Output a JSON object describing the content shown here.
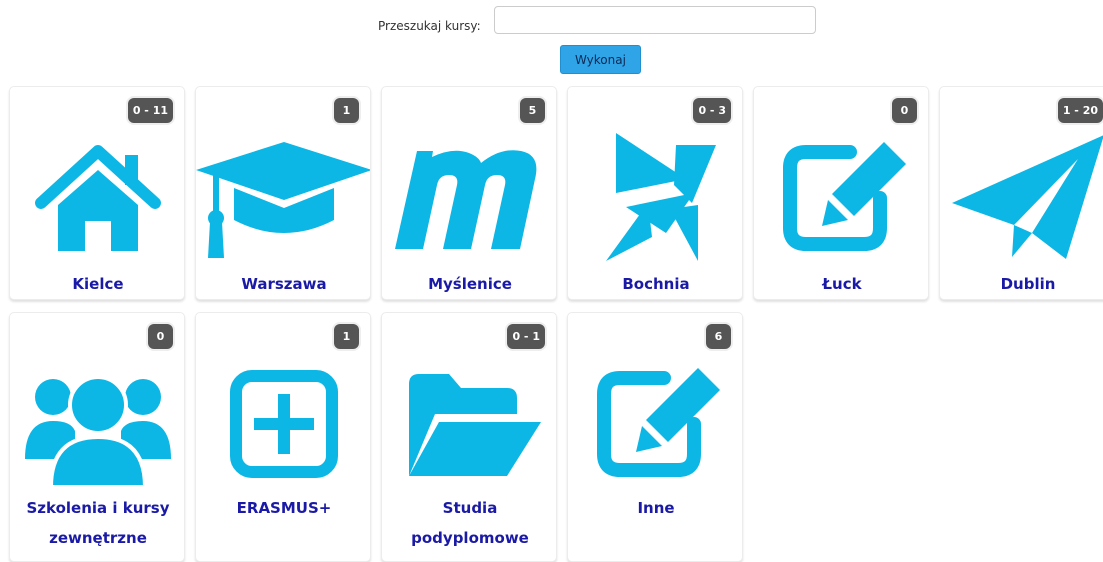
{
  "search": {
    "label": "Przeszukaj kursy:",
    "value": "",
    "placeholder": "",
    "submit_label": "Wykonaj"
  },
  "colors": {
    "icon": "#0cb6e5",
    "title": "#1a1aa6",
    "badge_bg": "#555555",
    "button_bg": "#2fa4e7"
  },
  "categories": [
    {
      "name": "Kielce",
      "count": "0 - 11",
      "icon": "home-icon"
    },
    {
      "name": "Warszawa",
      "count": "1",
      "icon": "graduation-cap-icon"
    },
    {
      "name": "Myślenice",
      "count": "5",
      "icon": "moodle-m-icon"
    },
    {
      "name": "Bochnia",
      "count": "0 - 3",
      "icon": "pinwheel-icon"
    },
    {
      "name": "Łuck",
      "count": "0",
      "icon": "edit-icon"
    },
    {
      "name": "Dublin",
      "count": "1 - 20",
      "icon": "paper-plane-icon"
    },
    {
      "name": "Szkolenia i kursy zewnętrzne",
      "count": "0",
      "icon": "users-icon"
    },
    {
      "name": "ERASMUS+",
      "count": "1",
      "icon": "plus-square-icon"
    },
    {
      "name": "Studia podyplomowe",
      "count": "0 - 1",
      "icon": "folder-open-icon"
    },
    {
      "name": "Inne",
      "count": "6",
      "icon": "edit-icon"
    }
  ]
}
